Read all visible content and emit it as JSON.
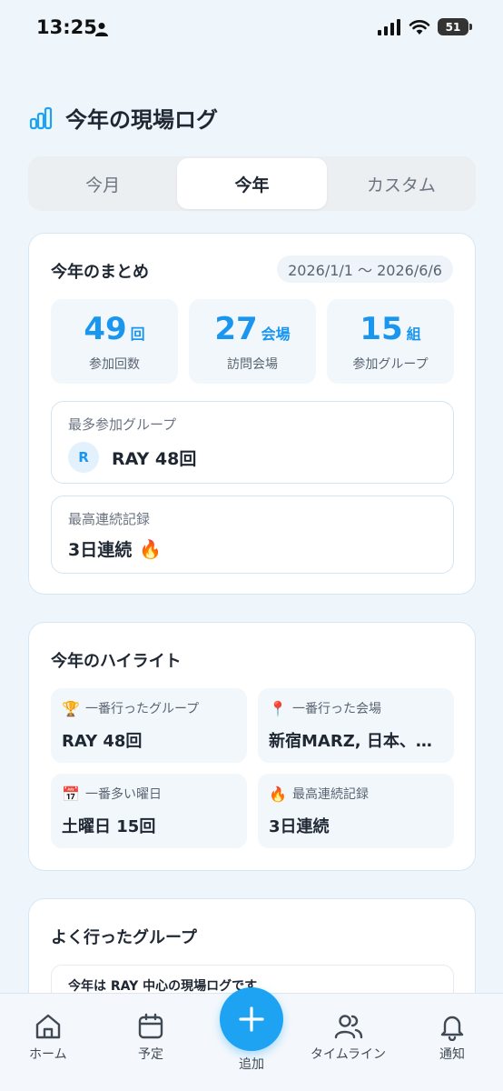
{
  "status_bar": {
    "time": "13:25",
    "battery": "51"
  },
  "header": {
    "title": "今年の現場ログ"
  },
  "segment": {
    "tabs": [
      "今月",
      "今年",
      "カスタム"
    ],
    "selected": "今年"
  },
  "summary": {
    "title": "今年のまとめ",
    "date_range": "2026/1/1 〜 2026/6/6",
    "stats": [
      {
        "value": "49",
        "unit": "回",
        "label": "参加回数"
      },
      {
        "value": "27",
        "unit": "会場",
        "label": "訪問会場"
      },
      {
        "value": "15",
        "unit": "組",
        "label": "参加グループ"
      }
    ],
    "top_group": {
      "label": "最多参加グループ",
      "avatar_letter": "R",
      "value": "RAY 48回"
    },
    "streak": {
      "label": "最高連続記録",
      "value": "3日連続",
      "emoji": "🔥"
    }
  },
  "highlights": {
    "title": "今年のハイライト",
    "items": [
      {
        "icon": "trophy-icon",
        "emoji": "🏆",
        "label": "一番行ったグループ",
        "value": "RAY 48回"
      },
      {
        "icon": "pin-icon",
        "emoji": "📍",
        "label": "一番行った会場",
        "value": "新宿MARZ, 日本、…"
      },
      {
        "icon": "calendar-icon",
        "emoji": "📅",
        "label": "一番多い曜日",
        "value": "土曜日 15回"
      },
      {
        "icon": "fire-icon",
        "emoji": "🔥",
        "label": "最高連続記録",
        "value": "3日連続"
      }
    ]
  },
  "groups": {
    "title": "よく行ったグループ",
    "note": "今年は RAY 中心の現場ログです"
  },
  "tabbar": {
    "home": "ホーム",
    "schedule": "予定",
    "add": "追加",
    "timeline": "タイムライン",
    "notifications": "通知"
  },
  "colors": {
    "accent": "#1ea3f3",
    "stat_text": "#1a96ef",
    "background": "#eef6fc"
  }
}
